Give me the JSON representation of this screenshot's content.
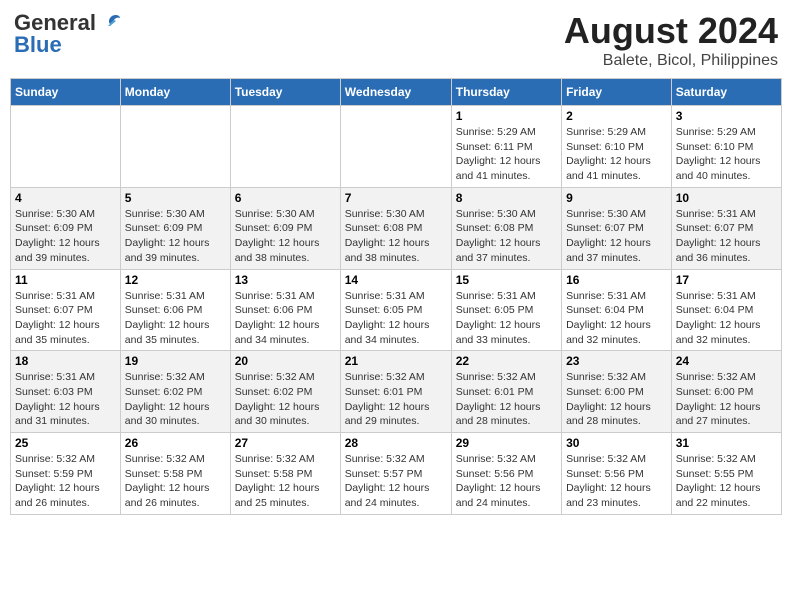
{
  "header": {
    "logo_general": "General",
    "logo_blue": "Blue",
    "title": "August 2024",
    "subtitle": "Balete, Bicol, Philippines"
  },
  "weekdays": [
    "Sunday",
    "Monday",
    "Tuesday",
    "Wednesday",
    "Thursday",
    "Friday",
    "Saturday"
  ],
  "weeks": [
    [
      {
        "day": "",
        "info": ""
      },
      {
        "day": "",
        "info": ""
      },
      {
        "day": "",
        "info": ""
      },
      {
        "day": "",
        "info": ""
      },
      {
        "day": "1",
        "info": "Sunrise: 5:29 AM\nSunset: 6:11 PM\nDaylight: 12 hours\nand 41 minutes."
      },
      {
        "day": "2",
        "info": "Sunrise: 5:29 AM\nSunset: 6:10 PM\nDaylight: 12 hours\nand 41 minutes."
      },
      {
        "day": "3",
        "info": "Sunrise: 5:29 AM\nSunset: 6:10 PM\nDaylight: 12 hours\nand 40 minutes."
      }
    ],
    [
      {
        "day": "4",
        "info": "Sunrise: 5:30 AM\nSunset: 6:09 PM\nDaylight: 12 hours\nand 39 minutes."
      },
      {
        "day": "5",
        "info": "Sunrise: 5:30 AM\nSunset: 6:09 PM\nDaylight: 12 hours\nand 39 minutes."
      },
      {
        "day": "6",
        "info": "Sunrise: 5:30 AM\nSunset: 6:09 PM\nDaylight: 12 hours\nand 38 minutes."
      },
      {
        "day": "7",
        "info": "Sunrise: 5:30 AM\nSunset: 6:08 PM\nDaylight: 12 hours\nand 38 minutes."
      },
      {
        "day": "8",
        "info": "Sunrise: 5:30 AM\nSunset: 6:08 PM\nDaylight: 12 hours\nand 37 minutes."
      },
      {
        "day": "9",
        "info": "Sunrise: 5:30 AM\nSunset: 6:07 PM\nDaylight: 12 hours\nand 37 minutes."
      },
      {
        "day": "10",
        "info": "Sunrise: 5:31 AM\nSunset: 6:07 PM\nDaylight: 12 hours\nand 36 minutes."
      }
    ],
    [
      {
        "day": "11",
        "info": "Sunrise: 5:31 AM\nSunset: 6:07 PM\nDaylight: 12 hours\nand 35 minutes."
      },
      {
        "day": "12",
        "info": "Sunrise: 5:31 AM\nSunset: 6:06 PM\nDaylight: 12 hours\nand 35 minutes."
      },
      {
        "day": "13",
        "info": "Sunrise: 5:31 AM\nSunset: 6:06 PM\nDaylight: 12 hours\nand 34 minutes."
      },
      {
        "day": "14",
        "info": "Sunrise: 5:31 AM\nSunset: 6:05 PM\nDaylight: 12 hours\nand 34 minutes."
      },
      {
        "day": "15",
        "info": "Sunrise: 5:31 AM\nSunset: 6:05 PM\nDaylight: 12 hours\nand 33 minutes."
      },
      {
        "day": "16",
        "info": "Sunrise: 5:31 AM\nSunset: 6:04 PM\nDaylight: 12 hours\nand 32 minutes."
      },
      {
        "day": "17",
        "info": "Sunrise: 5:31 AM\nSunset: 6:04 PM\nDaylight: 12 hours\nand 32 minutes."
      }
    ],
    [
      {
        "day": "18",
        "info": "Sunrise: 5:31 AM\nSunset: 6:03 PM\nDaylight: 12 hours\nand 31 minutes."
      },
      {
        "day": "19",
        "info": "Sunrise: 5:32 AM\nSunset: 6:02 PM\nDaylight: 12 hours\nand 30 minutes."
      },
      {
        "day": "20",
        "info": "Sunrise: 5:32 AM\nSunset: 6:02 PM\nDaylight: 12 hours\nand 30 minutes."
      },
      {
        "day": "21",
        "info": "Sunrise: 5:32 AM\nSunset: 6:01 PM\nDaylight: 12 hours\nand 29 minutes."
      },
      {
        "day": "22",
        "info": "Sunrise: 5:32 AM\nSunset: 6:01 PM\nDaylight: 12 hours\nand 28 minutes."
      },
      {
        "day": "23",
        "info": "Sunrise: 5:32 AM\nSunset: 6:00 PM\nDaylight: 12 hours\nand 28 minutes."
      },
      {
        "day": "24",
        "info": "Sunrise: 5:32 AM\nSunset: 6:00 PM\nDaylight: 12 hours\nand 27 minutes."
      }
    ],
    [
      {
        "day": "25",
        "info": "Sunrise: 5:32 AM\nSunset: 5:59 PM\nDaylight: 12 hours\nand 26 minutes."
      },
      {
        "day": "26",
        "info": "Sunrise: 5:32 AM\nSunset: 5:58 PM\nDaylight: 12 hours\nand 26 minutes."
      },
      {
        "day": "27",
        "info": "Sunrise: 5:32 AM\nSunset: 5:58 PM\nDaylight: 12 hours\nand 25 minutes."
      },
      {
        "day": "28",
        "info": "Sunrise: 5:32 AM\nSunset: 5:57 PM\nDaylight: 12 hours\nand 24 minutes."
      },
      {
        "day": "29",
        "info": "Sunrise: 5:32 AM\nSunset: 5:56 PM\nDaylight: 12 hours\nand 24 minutes."
      },
      {
        "day": "30",
        "info": "Sunrise: 5:32 AM\nSunset: 5:56 PM\nDaylight: 12 hours\nand 23 minutes."
      },
      {
        "day": "31",
        "info": "Sunrise: 5:32 AM\nSunset: 5:55 PM\nDaylight: 12 hours\nand 22 minutes."
      }
    ]
  ]
}
